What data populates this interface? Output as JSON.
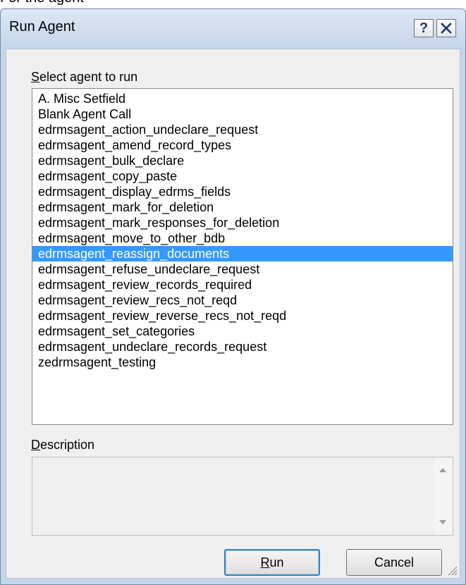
{
  "page_text": "For the agent",
  "window": {
    "title": "Run Agent",
    "help_label": "?"
  },
  "select_label": {
    "accel": "S",
    "rest": "elect agent to run"
  },
  "agents": [
    "A. Misc Setfield",
    "Blank Agent Call",
    "edrmsagent_action_undeclare_request",
    "edrmsagent_amend_record_types",
    "edrmsagent_bulk_declare",
    "edrmsagent_copy_paste",
    "edrmsagent_display_edrms_fields",
    "edrmsagent_mark_for_deletion",
    "edrmsagent_mark_responses_for_deletion",
    "edrmsagent_move_to_other_bdb",
    "edrmsagent_reassign_documents",
    "edrmsagent_refuse_undeclare_request",
    "edrmsagent_review_records_required",
    "edrmsagent_review_recs_not_reqd",
    "edrmsagent_review_reverse_recs_not_reqd",
    "edrmsagent_set_categories",
    "edrmsagent_undeclare_records_request",
    "zedrmsagent_testing"
  ],
  "selected_agent": "edrmsagent_reassign_documents",
  "description_label": {
    "accel": "D",
    "rest": "escription"
  },
  "description_text": "",
  "buttons": {
    "run": {
      "accel": "R",
      "rest": "un"
    },
    "cancel": "Cancel"
  },
  "colors": {
    "selection": "#3399ff",
    "window_frame": "#c5d6ea",
    "client_bg": "#f0f0f0"
  },
  "icons": {
    "help": "question-mark",
    "close": "x-close",
    "scroll_up": "triangle-up",
    "scroll_down": "triangle-down",
    "resize_grip": "diagonal-grip"
  }
}
